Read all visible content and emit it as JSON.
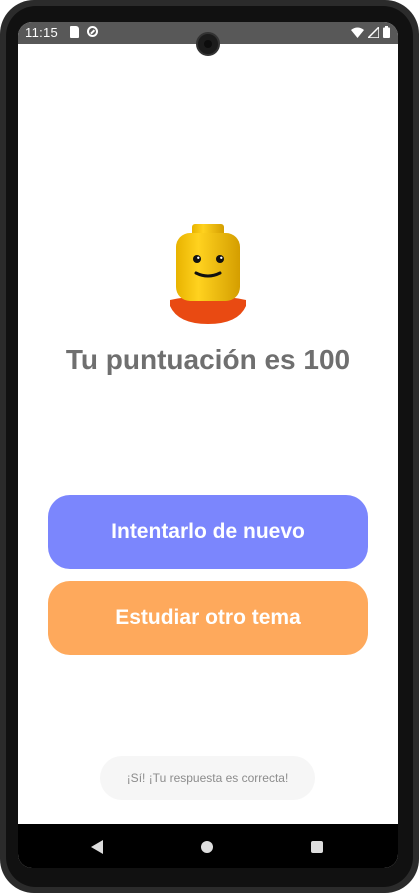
{
  "status_bar": {
    "time": "11:15",
    "left_icons": [
      "sd-card-icon",
      "do-not-disturb-icon"
    ],
    "right_icons": [
      "wifi-icon",
      "signal-icon",
      "battery-icon"
    ]
  },
  "result": {
    "mascot_icon": "lego-head-icon",
    "score_text": "Tu puntuación es 100"
  },
  "actions": {
    "retry_label": "Intentarlo de nuevo",
    "retry_color": "#7b86fd",
    "other_topic_label": "Estudiar otro tema",
    "other_topic_color": "#fea95c"
  },
  "toast": {
    "message": "¡Sí! ¡Tu respuesta es correcta!"
  },
  "nav_bar": {
    "icons": [
      "back-icon",
      "home-icon",
      "recents-icon"
    ]
  }
}
